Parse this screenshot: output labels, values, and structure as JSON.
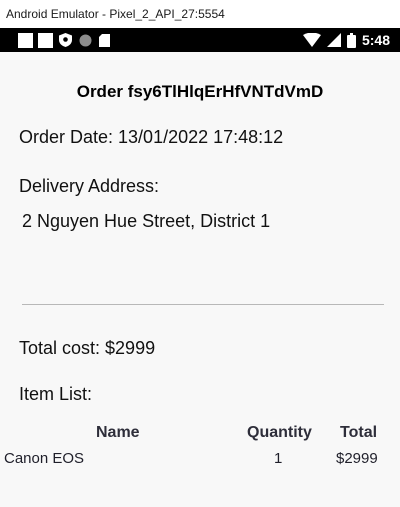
{
  "window": {
    "title": "Android Emulator - Pixel_2_API_27:5554"
  },
  "status_bar": {
    "time": "5:48",
    "icons": [
      "notification-square-icon",
      "notification-square-icon",
      "shield-icon",
      "circle-icon",
      "sd-card-icon",
      "wifi-icon",
      "signal-icon",
      "battery-icon"
    ]
  },
  "order": {
    "title": "Order fsy6TlHlqErHfVNTdVmD",
    "date_line": "Order Date: 13/01/2022 17:48:12",
    "address_label": "Delivery Address:",
    "address": "2 Nguyen Hue Street, District 1",
    "total_line": "Total cost: $2999",
    "item_list_label": "Item List:"
  },
  "items_table": {
    "headers": {
      "name": "Name",
      "quantity": "Quantity",
      "total": "Total"
    },
    "rows": [
      {
        "name": "Canon EOS",
        "quantity": "1",
        "total": "$2999"
      }
    ]
  },
  "colors": {
    "app_background": "#f8f8f8",
    "status_bar": "#000000",
    "divider": "#b8b8b8"
  }
}
